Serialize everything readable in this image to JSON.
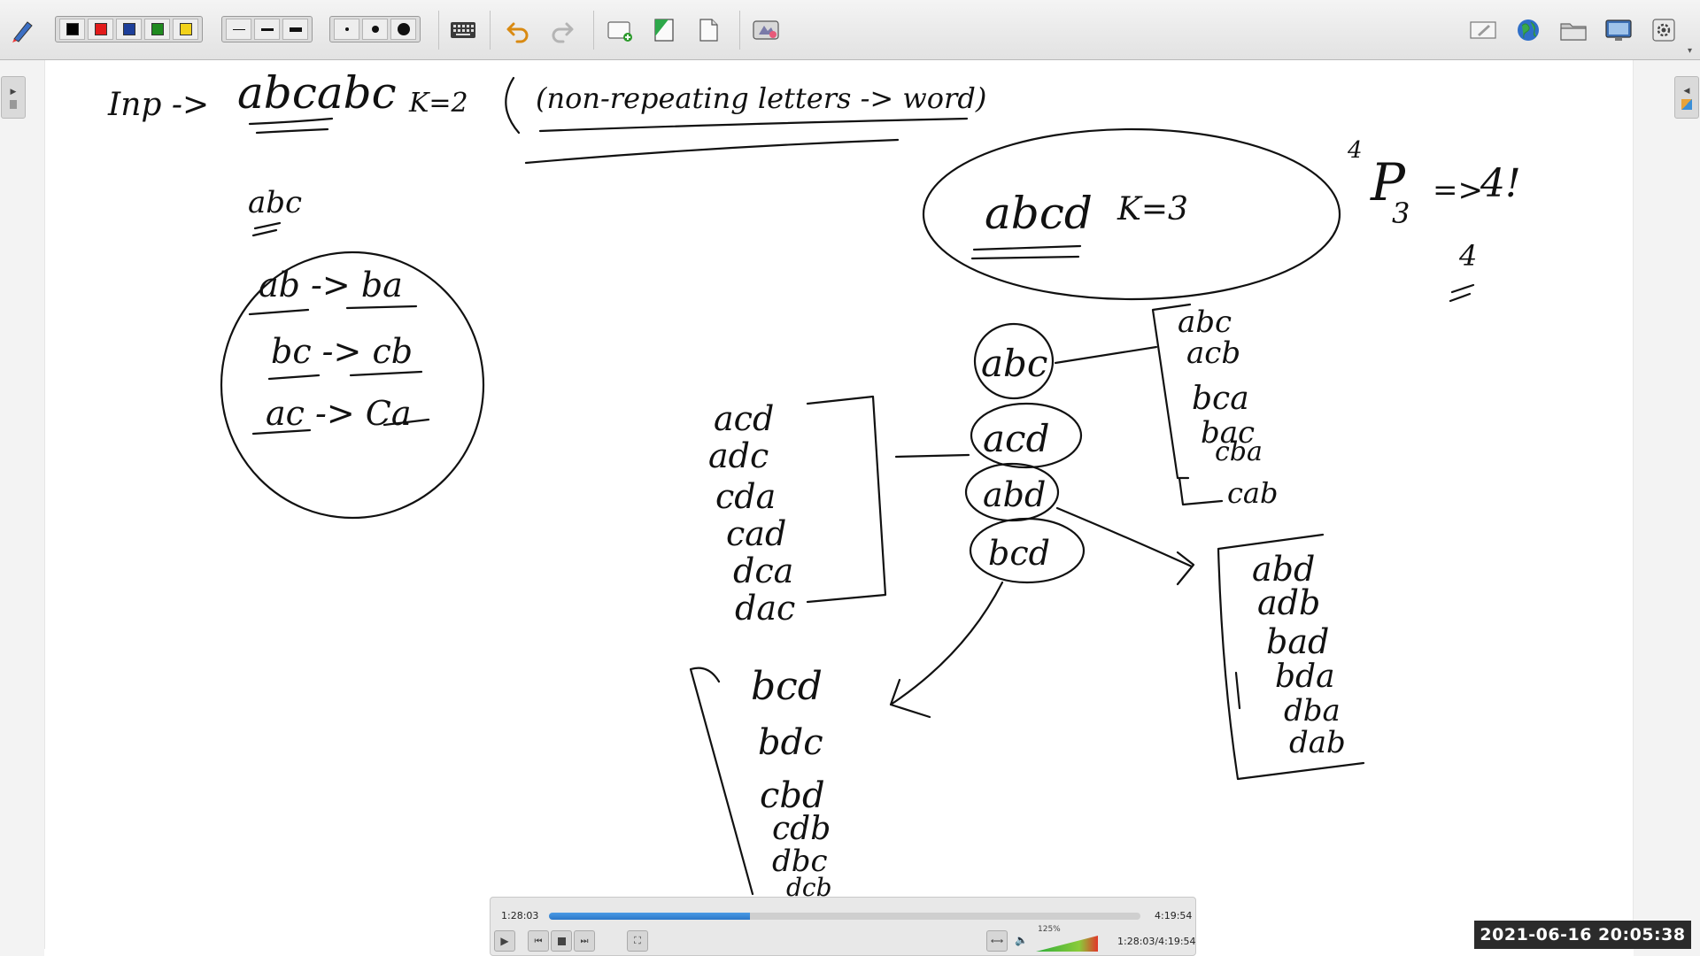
{
  "toolbar": {
    "colors": [
      "#000000",
      "#e21b1b",
      "#1d3f9a",
      "#1f8a1f",
      "#f2d21a"
    ],
    "line_widths": [
      "thin",
      "medium",
      "thick"
    ],
    "dot_sizes": [
      "small",
      "medium",
      "large"
    ],
    "icons": [
      "pen-tool-icon",
      "keyboard-icon",
      "undo-icon",
      "redo-icon",
      "add-page-icon",
      "green-page-icon",
      "page-icon",
      "screen-capture-icon",
      "edit-icon",
      "globe-icon",
      "folder-icon",
      "monitor-icon",
      "settings-icon"
    ]
  },
  "whiteboard": {
    "title_line": {
      "prefix": "Inp ->",
      "input": "abcabc",
      "k": "K=2",
      "note": "(non-repeating letters -> word)"
    },
    "left_example": {
      "heading": "abc",
      "pairs": [
        "ab -> ba",
        "bc -> cb",
        "ac -> Ca"
      ]
    },
    "main_example": {
      "input": "abcd",
      "k": "K=3"
    },
    "perm_formula": {
      "n": "4",
      "p": "P",
      "r": "3",
      "arrow": "=>",
      "result": "4!",
      "extra": "4"
    },
    "groups": [
      "abc",
      "acd",
      "abd",
      "bcd"
    ],
    "abc_list": [
      "abc",
      "acb",
      "bca",
      "bac",
      "cba",
      "cab"
    ],
    "acd_list": [
      "acd",
      "adc",
      "cda",
      "cad",
      "dca",
      "dac"
    ],
    "abd_list": [
      "abd",
      "adb",
      "bad",
      "bda",
      "dba",
      "dab"
    ],
    "bcd_list": [
      "bcd",
      "bdc",
      "cbd",
      "cdb",
      "dbc",
      "dcb"
    ]
  },
  "player": {
    "current_time": "1:28:03",
    "total_time": "4:19:54",
    "combined_time": "1:28:03/4:19:54",
    "progress": 0.34,
    "zoom": "125%"
  },
  "timestamp": "2021-06-16  20:05:38"
}
